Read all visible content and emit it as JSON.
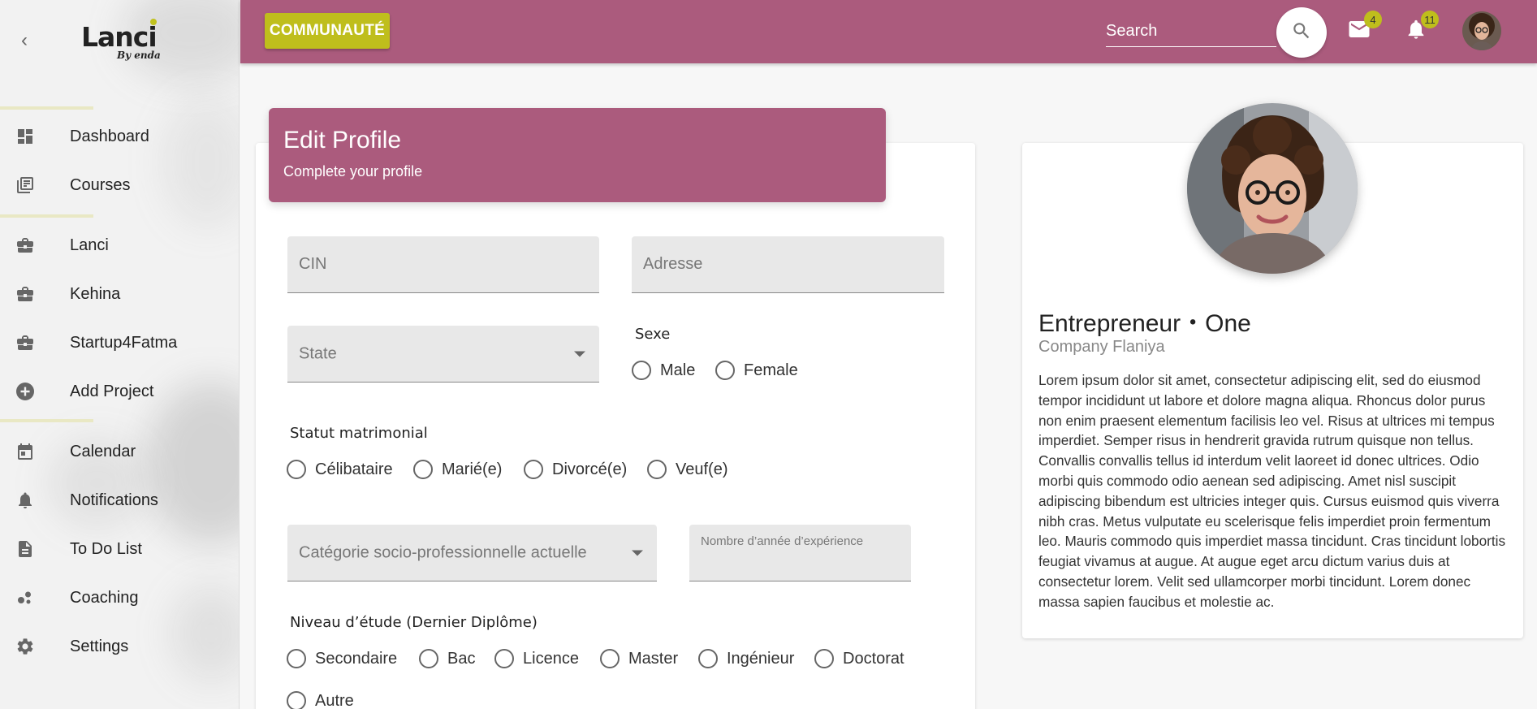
{
  "sidebar": {
    "logo_text": "Lanci",
    "logo_tagline": "By enda",
    "items": [
      {
        "label": "Dashboard",
        "icon": "dashboard-icon"
      },
      {
        "label": "Courses",
        "icon": "courses-icon"
      },
      {
        "label": "Lanci",
        "icon": "briefcase-icon"
      },
      {
        "label": "Kehina",
        "icon": "briefcase-icon"
      },
      {
        "label": "Startup4Fatma",
        "icon": "briefcase-icon"
      },
      {
        "label": "Add Project",
        "icon": "add-circle-icon"
      },
      {
        "label": "Calendar",
        "icon": "calendar-icon"
      },
      {
        "label": "Notifications",
        "icon": "bell-icon"
      },
      {
        "label": "To Do List",
        "icon": "document-icon"
      },
      {
        "label": "Coaching",
        "icon": "bubbles-icon"
      },
      {
        "label": "Settings",
        "icon": "gear-icon"
      }
    ]
  },
  "topbar": {
    "community_label": "COMMUNAUTÉ",
    "search_placeholder": "Search",
    "mail_count": "4",
    "notification_count": "11"
  },
  "form": {
    "title": "Edit Profile",
    "subtitle": "Complete your profile",
    "cin_placeholder": "CIN",
    "adresse_placeholder": "Adresse",
    "state_label": "State",
    "sexe_label": "Sexe",
    "sexe_options": [
      "Male",
      "Female"
    ],
    "statut_label": "Statut matrimonial",
    "statut_options": [
      "Célibataire",
      "Marié(e)",
      "Divorcé(e)",
      "Veuf(e)"
    ],
    "categorie_label": "Catégorie socio-professionnelle actuelle",
    "experience_label": "Nombre d’année d’expérience",
    "niveau_label": "Niveau d’étude (Dernier Diplôme)",
    "niveau_options": [
      "Secondaire",
      "Bac",
      "Licence",
      "Master",
      "Ingénieur",
      "Doctorat",
      "Autre"
    ]
  },
  "profile": {
    "name": "Entrepreneur・One",
    "company": "Company Flaniya",
    "bio": "Lorem ipsum dolor sit amet, consectetur adipiscing elit, sed do eiusmod tempor incididunt ut labore et dolore magna aliqua. Rhoncus dolor purus non enim praesent elementum facilisis leo vel. Risus at ultrices mi tempus imperdiet. Semper risus in hendrerit gravida rutrum quisque non tellus. Convallis convallis tellus id interdum velit laoreet id donec ultrices. Odio morbi quis commodo odio aenean sed adipiscing. Amet nisl suscipit adipiscing bibendum est ultricies integer quis. Cursus euismod quis viverra nibh cras. Metus vulputate eu scelerisque felis imperdiet proin fermentum leo. Mauris commodo quis imperdiet massa tincidunt. Cras tincidunt lobortis feugiat vivamus at augue. At augue eget arcu dictum varius duis at consectetur lorem. Velit sed ullamcorper morbi tincidunt. Lorem donec massa sapien faucibus et molestie ac."
  },
  "colors": {
    "primary": "#ab5b7d",
    "accent": "#bfbe1c"
  }
}
